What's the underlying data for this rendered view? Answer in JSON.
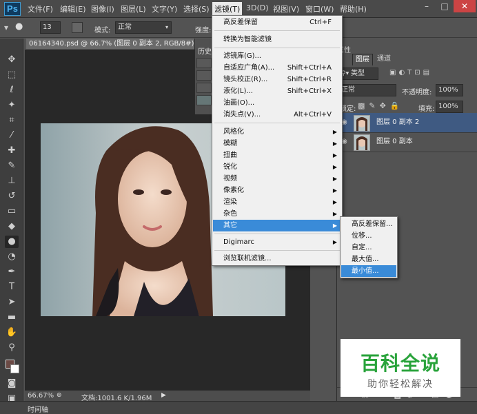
{
  "app": {
    "logo": "Ps"
  },
  "menubar": {
    "items": [
      "文件(F)",
      "编辑(E)",
      "图像(I)",
      "图层(L)",
      "文字(Y)",
      "选择(S)",
      "滤镜(T)",
      "3D(D)",
      "视图(V)",
      "窗口(W)",
      "帮助(H)"
    ],
    "active_item": "滤镜(T)"
  },
  "options_bar": {
    "brush_size": "13",
    "mode_label": "模式:",
    "mode_value": "正常",
    "strength_label": "强度:"
  },
  "document": {
    "tab_title": "06164340.psd @ 66.7% (图层 0 副本 2, RGB/8#) *",
    "zoom": "66.67%",
    "doc_info": "文档:1001.6 K/1.96M"
  },
  "panels": {
    "history_tab": "历史",
    "properties_tab": "属性"
  },
  "layers_panel": {
    "tabs": [
      "图层",
      "通道"
    ],
    "kind_label": "类型",
    "blend_mode": "正常",
    "opacity_label": "不透明度:",
    "opacity_value": "100%",
    "lock_label": "锁定:",
    "fill_label": "填充:",
    "fill_value": "100%",
    "layers": [
      {
        "name": "图层 0 副本 2",
        "selected": true
      },
      {
        "name": "图层 0 副本",
        "selected": false
      }
    ]
  },
  "filter_menu": {
    "items": [
      {
        "label": "高反差保留",
        "shortcut": "Ctrl+F"
      },
      {
        "label": "转换为智能滤镜",
        "shortcut": ""
      },
      {
        "label": "滤镜库(G)...",
        "shortcut": ""
      },
      {
        "label": "自适应广角(A)...",
        "shortcut": "Shift+Ctrl+A"
      },
      {
        "label": "镜头校正(R)...",
        "shortcut": "Shift+Ctrl+R"
      },
      {
        "label": "液化(L)...",
        "shortcut": "Shift+Ctrl+X"
      },
      {
        "label": "油画(O)...",
        "shortcut": ""
      },
      {
        "label": "消失点(V)...",
        "shortcut": "Alt+Ctrl+V"
      },
      {
        "label": "风格化",
        "shortcut": ""
      },
      {
        "label": "模糊",
        "shortcut": ""
      },
      {
        "label": "扭曲",
        "shortcut": ""
      },
      {
        "label": "锐化",
        "shortcut": ""
      },
      {
        "label": "视频",
        "shortcut": ""
      },
      {
        "label": "像素化",
        "shortcut": ""
      },
      {
        "label": "渲染",
        "shortcut": ""
      },
      {
        "label": "杂色",
        "shortcut": ""
      },
      {
        "label": "其它",
        "shortcut": ""
      },
      {
        "label": "Digimarc",
        "shortcut": ""
      },
      {
        "label": "浏览联机滤镜...",
        "shortcut": ""
      }
    ],
    "highlighted": "其它"
  },
  "other_submenu": {
    "items": [
      "高反差保留...",
      "位移...",
      "自定...",
      "最大值...",
      "最小值..."
    ],
    "highlighted": "最小值..."
  },
  "status": {
    "timeline_label": "时间轴"
  },
  "watermark": {
    "title": "百科全说",
    "subtitle": "助你轻松解决"
  },
  "colors": {
    "menu_highlight": "#3a8bd8",
    "layer_selected": "#3f5a82",
    "watermark_green": "#29a33b"
  }
}
